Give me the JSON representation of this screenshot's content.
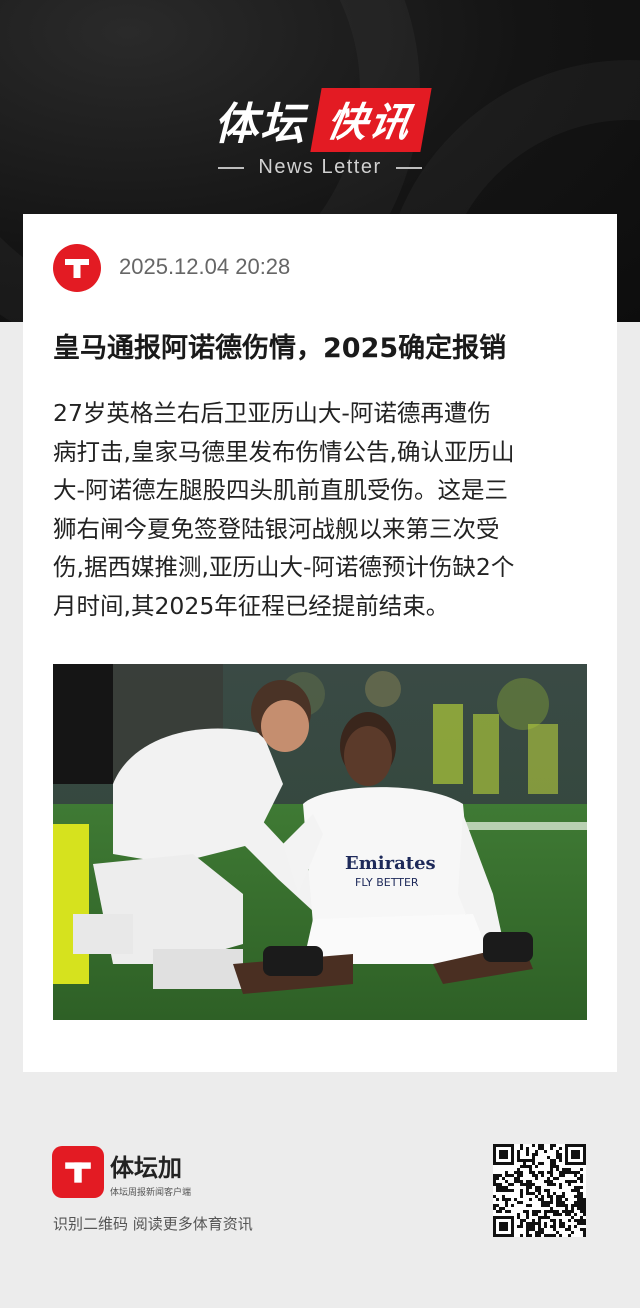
{
  "banner": {
    "brand_left": "体坛",
    "brand_right": "快讯",
    "subtitle": "News Letter"
  },
  "post": {
    "timestamp": "2025.12.04 20:28",
    "headline": "皇马通报阿诺德伤情，2025确定报销",
    "body_lines": [
      "27岁英格兰右后卫亚历山大-阿诺德再遭伤",
      "病打击,皇家马德里发布伤情公告,确认亚历山",
      "大-阿诺德左腿股四头肌前直肌受伤。这是三",
      "狮右闸今夏免签登陆银河战舰以来第三次受",
      "伤,据西媒推测,亚历山大-阿诺德预计伤缺2个",
      "月时间,其2025年征程已经提前结束。"
    ],
    "photo_jersey_text": {
      "sponsor": "Emirates",
      "slogan": "FLY BETTER"
    }
  },
  "footer": {
    "app_name": "体坛加",
    "app_subtitle": "体坛周报新闻客户端",
    "tagline": "识别二维码 阅读更多体育资讯"
  },
  "colors": {
    "brand_red": "#e31b23",
    "banner_dark": "#141414",
    "page_bg": "#ececec"
  },
  "icons": {
    "avatar": "t-logo-icon",
    "footer_logo": "t-logo-icon",
    "qr": "qr-code"
  }
}
